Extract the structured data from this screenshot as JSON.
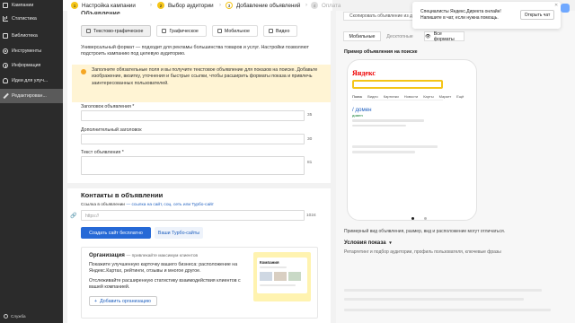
{
  "sidebar": {
    "items": [
      {
        "label": "Кампании",
        "icon": "campaigns-icon"
      },
      {
        "label": "Статистика",
        "icon": "statistics-icon"
      },
      {
        "label": "Библиотека",
        "icon": "library-icon"
      },
      {
        "label": "Инструменты",
        "icon": "tools-icon"
      },
      {
        "label": "Информация",
        "icon": "info-icon"
      },
      {
        "label": "Идеи для улуч...",
        "icon": "ideas-icon"
      },
      {
        "label": "Редактирован...",
        "icon": "edit-icon"
      }
    ],
    "support": "Служба"
  },
  "stepper": {
    "steps": [
      {
        "num": "1",
        "label": "Настройка кампании"
      },
      {
        "num": "2",
        "label": "Выбор аудитории"
      },
      {
        "num": "3",
        "label": "Добавление объявлений"
      },
      {
        "num": "4",
        "label": "Оплата"
      }
    ]
  },
  "main": {
    "header_fragment": "Объявление",
    "format_tabs": [
      "Текстово-графическое",
      "Графическое",
      "Мобильное",
      "Видео"
    ],
    "format_desc": "Универсальный формат — подходит для рекламы большинства товаров и услуг. Настройки позволяют подстроить кампанию под целевую аудиторию.",
    "warning": "Заполните обязательные поля и вы получите текстовое объявление для показов на поиске. Добавьте изображение, визитку, уточнения и быстрые ссылки, чтобы расширить форматы показа и привлечь заинтересованных пользователей.",
    "fields": [
      {
        "label": "Заголовок объявления *",
        "counter": "35"
      },
      {
        "label": "Дополнительный заголовок",
        "counter": "30"
      },
      {
        "label": "Текст объявления *",
        "counter": "81"
      }
    ],
    "contacts_title": "Контакты в объявлении",
    "link_label": "Ссылка в объявлении",
    "link_hint": "— ссылка на сайт, соц. сеть или Турбо-сайт",
    "link_placeholder": "https://",
    "link_counter": "1024",
    "create_site_btn": "Создать сайт бесплатно",
    "turbo_btn": "Ваши Турбо-сайты",
    "org": {
      "title": "Организация",
      "subtitle": "— привлекайте максимум клиентов",
      "text1": "Покажите улучшенную карточку вашего бизнеса: расположение на Яндекс.Картах, рейтинги, отзывы и многое другое.",
      "text2": "Отслеживайте расширенную статистику взаимодействия клиентов с вашей компанией.",
      "add_btn": "Добавить организацию",
      "preview_label": "Компания"
    }
  },
  "right": {
    "copy_btn": "Скопировать объявление из другой",
    "tabs": [
      "Мобильные",
      "Десктопные"
    ],
    "all_formats": "Все форматы",
    "preview_title": "Пример объявления на поиске",
    "yandex_logo": "Яндекс",
    "search_menu": [
      "Поиск",
      "Видео",
      "Картинки",
      "Новости",
      "Карты",
      "Маркет",
      "Ещё"
    ],
    "ad_title": "/ домен",
    "ad_domain": "домен",
    "caption": "Примерный вид объявления, размер, вид и расположение могут отличаться.",
    "conditions_title": "Условия показа",
    "conditions_sub": "Ретаргетинг и подбор аудитории, профиль пользователя, ключевые фразы"
  },
  "toast": {
    "text": "Специалисты Яндекс.Директа онлайн! Напишите в чат, если нужна помощь.",
    "button": "Открыть чат"
  },
  "colors": {
    "sidebar_bg": "#2b2b2b",
    "accent_yellow": "#f5c518",
    "primary_blue": "#2669d6",
    "warning_bg": "#fff4d4"
  }
}
